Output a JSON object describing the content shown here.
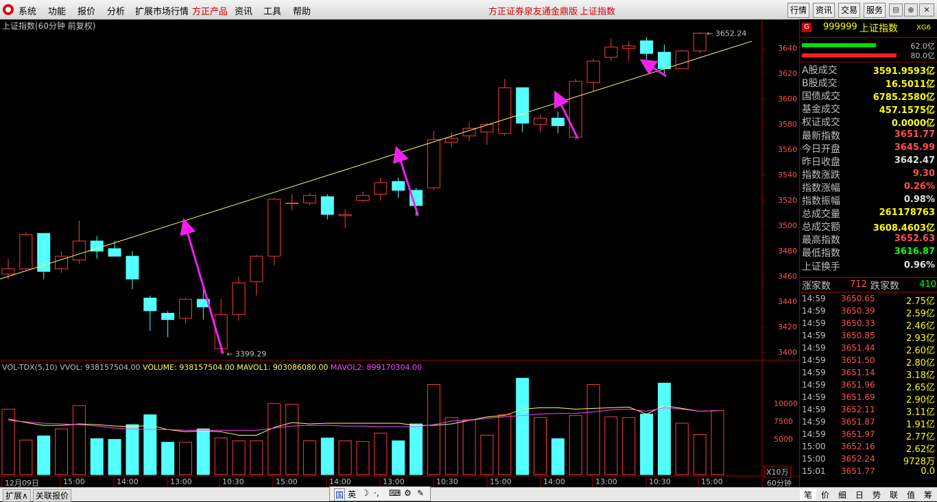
{
  "menubar": {
    "items": [
      "系统",
      "功能",
      "报价",
      "分析",
      "扩展市场行情",
      "方正产品",
      "资讯",
      "工具",
      "帮助"
    ],
    "center_title": "方正证券泉友通金鼎版",
    "center_index": "上证指数",
    "right_buttons": [
      "行情",
      "资讯",
      "交易",
      "服务"
    ],
    "window_buttons": [
      "⊟",
      "⊕",
      "⊟",
      "✕"
    ]
  },
  "chart": {
    "title": "上证指数(60分钟 前复权)",
    "high_label": "3652.24",
    "low_label": "3399.29",
    "y_ticks": [
      "3640",
      "3620",
      "3600",
      "3580",
      "3560",
      "3540",
      "3520",
      "3500",
      "3480",
      "3460",
      "3440",
      "3420",
      "3400"
    ],
    "vol_ticks": [
      "10000",
      "7500",
      "5000"
    ],
    "vol_unit": "X10万",
    "x_ticks": [
      "12月09日",
      "15:00",
      "14:00",
      "13:00",
      "10:30",
      "15:00",
      "14:00",
      "13:00",
      "10:30",
      "15:00",
      "14:00",
      "13:00",
      "10:30",
      "15:00"
    ],
    "period_label": "60分钟"
  },
  "vol_legend": {
    "name": "VOL-TDX(5,10)",
    "vvol": "VVOL: 938157504.00",
    "volume": "VOLUME: 938157504.00",
    "mavol1": "MAVOL1: 903086080.00",
    "mavol2": "MAVOL2: 899170304.00"
  },
  "colors": {
    "up": "#ff3c3c",
    "down": "#54ffff",
    "trend": "#ffff66",
    "arrow": "#ee22ee",
    "ma1": "#ffff66",
    "ma2": "#ff44ff"
  },
  "chart_data": {
    "type": "candlestick",
    "candles": [
      {
        "o": 3462,
        "h": 3474,
        "l": 3458,
        "c": 3466
      },
      {
        "o": 3466,
        "h": 3495,
        "l": 3465,
        "c": 3493
      },
      {
        "o": 3494,
        "h": 3494,
        "l": 3458,
        "c": 3464
      },
      {
        "o": 3466,
        "h": 3480,
        "l": 3463,
        "c": 3476
      },
      {
        "o": 3473,
        "h": 3504,
        "l": 3470,
        "c": 3488
      },
      {
        "o": 3488,
        "h": 3492,
        "l": 3474,
        "c": 3480
      },
      {
        "o": 3482,
        "h": 3488,
        "l": 3476,
        "c": 3476
      },
      {
        "o": 3476,
        "h": 3480,
        "l": 3450,
        "c": 3458
      },
      {
        "o": 3443,
        "h": 3445,
        "l": 3417,
        "c": 3433
      },
      {
        "o": 3431,
        "h": 3433,
        "l": 3412,
        "c": 3426
      },
      {
        "o": 3427,
        "h": 3443,
        "l": 3423,
        "c": 3442
      },
      {
        "o": 3442,
        "h": 3454,
        "l": 3426,
        "c": 3436
      },
      {
        "o": 3403,
        "h": 3442,
        "l": 3399,
        "c": 3430
      },
      {
        "o": 3430,
        "h": 3460,
        "l": 3425,
        "c": 3455
      },
      {
        "o": 3456,
        "h": 3477,
        "l": 3445,
        "c": 3476
      },
      {
        "o": 3476,
        "h": 3522,
        "l": 3469,
        "c": 3521
      },
      {
        "o": 3518,
        "h": 3525,
        "l": 3512,
        "c": 3518
      },
      {
        "o": 3518,
        "h": 3526,
        "l": 3516,
        "c": 3524
      },
      {
        "o": 3523,
        "h": 3525,
        "l": 3505,
        "c": 3509
      },
      {
        "o": 3508,
        "h": 3513,
        "l": 3498,
        "c": 3509
      },
      {
        "o": 3520,
        "h": 3527,
        "l": 3519,
        "c": 3524
      },
      {
        "o": 3525,
        "h": 3538,
        "l": 3520,
        "c": 3534
      },
      {
        "o": 3535,
        "h": 3538,
        "l": 3522,
        "c": 3528
      },
      {
        "o": 3528,
        "h": 3530,
        "l": 3508,
        "c": 3516
      },
      {
        "o": 3530,
        "h": 3575,
        "l": 3528,
        "c": 3568
      },
      {
        "o": 3566,
        "h": 3574,
        "l": 3562,
        "c": 3569
      },
      {
        "o": 3571,
        "h": 3582,
        "l": 3567,
        "c": 3577
      },
      {
        "o": 3574,
        "h": 3581,
        "l": 3564,
        "c": 3580
      },
      {
        "o": 3573,
        "h": 3616,
        "l": 3571,
        "c": 3609
      },
      {
        "o": 3609,
        "h": 3609,
        "l": 3574,
        "c": 3581
      },
      {
        "o": 3580,
        "h": 3588,
        "l": 3574,
        "c": 3585
      },
      {
        "o": 3585,
        "h": 3590,
        "l": 3573,
        "c": 3579
      },
      {
        "o": 3570,
        "h": 3616,
        "l": 3568,
        "c": 3614
      },
      {
        "o": 3613,
        "h": 3632,
        "l": 3606,
        "c": 3630
      },
      {
        "o": 3633,
        "h": 3648,
        "l": 3630,
        "c": 3641
      },
      {
        "o": 3640,
        "h": 3646,
        "l": 3630,
        "c": 3642
      },
      {
        "o": 3646,
        "h": 3649,
        "l": 3631,
        "c": 3636
      },
      {
        "o": 3637,
        "h": 3643,
        "l": 3620,
        "c": 3624
      },
      {
        "o": 3624,
        "h": 3639,
        "l": 3624,
        "c": 3638
      },
      {
        "o": 3638,
        "h": 3653,
        "l": 3636,
        "c": 3652
      }
    ],
    "volumes": [
      9300,
      4900,
      5500,
      6500,
      9800,
      5100,
      5000,
      7100,
      8500,
      4600,
      4600,
      6500,
      5200,
      4800,
      4800,
      10100,
      10000,
      4800,
      5200,
      4800,
      4700,
      5900,
      4800,
      7200,
      12800,
      8100,
      7800,
      5600,
      8500,
      13700,
      8100,
      5100,
      8400,
      12800,
      8200,
      8100,
      8600,
      13000,
      7300,
      5700,
      9100
    ],
    "ma1": [
      7900,
      7400,
      7000,
      7000,
      7200,
      7100,
      6900,
      6800,
      7000,
      6400,
      6100,
      6200,
      6100,
      5600,
      5600,
      6700,
      7400,
      7200,
      7300,
      7300,
      7300,
      7300,
      7300,
      7000,
      7000,
      7200,
      7700,
      8200,
      8400,
      9300,
      9500,
      9500,
      9300,
      9400,
      9500,
      9600,
      8600,
      9800,
      9400,
      9000,
      9100
    ],
    "ma2": [
      7700,
      7500,
      7300,
      7200,
      7100,
      6900,
      6600,
      6500,
      6400,
      6400,
      6300,
      6300,
      6300,
      6300,
      6300,
      6600,
      6900,
      7000,
      7000,
      6900,
      6900,
      6800,
      6800,
      6800,
      7100,
      7600,
      7700,
      8000,
      8200,
      8400,
      8600,
      8700,
      8700,
      8900,
      9200,
      9300,
      9000,
      9500,
      9300,
      9000,
      9100
    ],
    "trend_line": {
      "start": 3458,
      "end": 3650
    },
    "ylim": [
      3395,
      3662
    ],
    "vol_lim": [
      0,
      14500
    ]
  },
  "side": {
    "badge": "G",
    "code": "999999",
    "name": "上证指数",
    "suffix": "XG6",
    "bar_labels": [
      "62.0亿",
      "80.0亿"
    ],
    "rows": [
      {
        "label": "A股成交",
        "value": "3591.9593亿",
        "color": "#ffff00"
      },
      {
        "label": "B股成交",
        "value": "16.5011亿",
        "color": "#ffff00"
      },
      {
        "label": "国债成交",
        "value": "6785.2580亿",
        "color": "#ffff00"
      },
      {
        "label": "基金成交",
        "value": "457.1575亿",
        "color": "#ffff00"
      },
      {
        "label": "权证成交",
        "value": "0.0000亿",
        "color": "#ffff00"
      },
      {
        "label": "最新指数",
        "value": "3651.77",
        "color": "#ff5050"
      },
      {
        "label": "今日开盘",
        "value": "3645.99",
        "color": "#ff5050"
      },
      {
        "label": "昨日收盘",
        "value": "3642.47",
        "color": "#e0e0e0"
      },
      {
        "label": "指数涨跌",
        "value": "9.30",
        "color": "#ff5050"
      },
      {
        "label": "指数涨幅",
        "value": "0.26%",
        "color": "#ff5050"
      },
      {
        "label": "指数振幅",
        "value": "0.98%",
        "color": "#e0e0e0"
      },
      {
        "label": "总成交量",
        "value": "261178763",
        "color": "#ffff00"
      },
      {
        "label": "总成交额",
        "value": "3608.4603亿",
        "color": "#ffff00"
      },
      {
        "label": "最高指数",
        "value": "3652.63",
        "color": "#ff5050"
      },
      {
        "label": "最低指数",
        "value": "3616.87",
        "color": "#00ff00"
      },
      {
        "label": "上证换手",
        "value": "0.96%",
        "color": "#e0e0e0"
      }
    ],
    "up_label": "涨家数",
    "up_count": "712",
    "down_label": "跌家数",
    "down_count": "410",
    "ticks": [
      {
        "t": "14:59",
        "p": "3650.65",
        "q": "2.75亿"
      },
      {
        "t": "14:59",
        "p": "3650.39",
        "q": "2.59亿"
      },
      {
        "t": "14:59",
        "p": "3650.33",
        "q": "2.46亿"
      },
      {
        "t": "14:59",
        "p": "3650.85",
        "q": "2.93亿"
      },
      {
        "t": "14:59",
        "p": "3651.44",
        "q": "2.60亿"
      },
      {
        "t": "14:59",
        "p": "3651.50",
        "q": "2.80亿"
      },
      {
        "t": "14:59",
        "p": "3651.14",
        "q": "3.18亿"
      },
      {
        "t": "14:59",
        "p": "3651.96",
        "q": "2.65亿"
      },
      {
        "t": "14:59",
        "p": "3651.69",
        "q": "2.90亿"
      },
      {
        "t": "14:59",
        "p": "3652.11",
        "q": "3.11亿"
      },
      {
        "t": "14:59",
        "p": "3651.87",
        "q": "1.91亿"
      },
      {
        "t": "14:59",
        "p": "3651.97",
        "q": "2.77亿"
      },
      {
        "t": "15:00",
        "p": "3652.16",
        "q": "2.62亿"
      },
      {
        "t": "15:00",
        "p": "3652.24",
        "q": "9728万"
      },
      {
        "t": "15:01",
        "p": "3651.77",
        "q": "0.0"
      }
    ]
  },
  "bottom": {
    "left_tabs": [
      "扩展∧",
      "关联报价"
    ],
    "ime": [
      "国",
      "英",
      "☽",
      "·,",
      "⌨",
      "⚙",
      "✎"
    ],
    "right_tabs": [
      "笔",
      "价",
      "细",
      "日",
      "势",
      "联",
      "值",
      "筹"
    ]
  }
}
